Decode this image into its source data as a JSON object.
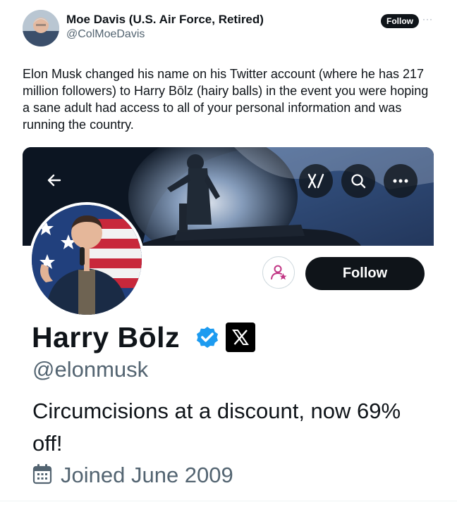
{
  "tweet": {
    "author_name": "Moe Davis (U.S. Air Force, Retired)",
    "author_handle": "@ColMoeDavis",
    "follow_label": "Follow",
    "more_label": "···",
    "text": "Elon Musk changed his name on his Twitter account (where he has 217 million followers) to Harry Bōlz (hairy balls) in the event you were hoping a sane adult had access to all of your personal information and was running the country."
  },
  "profile": {
    "display_name": "Harry Bōlz",
    "handle": "@elonmusk",
    "bio": "Circumcisions at a discount, now 69% off!",
    "joined": "Joined June 2009",
    "follow_label": "Follow",
    "verified_color": "#1d9bf0"
  },
  "banner_icons": [
    "back-arrow-icon",
    "grok-icon",
    "search-icon",
    "more-icon"
  ],
  "colors": {
    "accent_dark": "#0f1419",
    "muted": "#536471",
    "subscribe": "#c13584"
  }
}
